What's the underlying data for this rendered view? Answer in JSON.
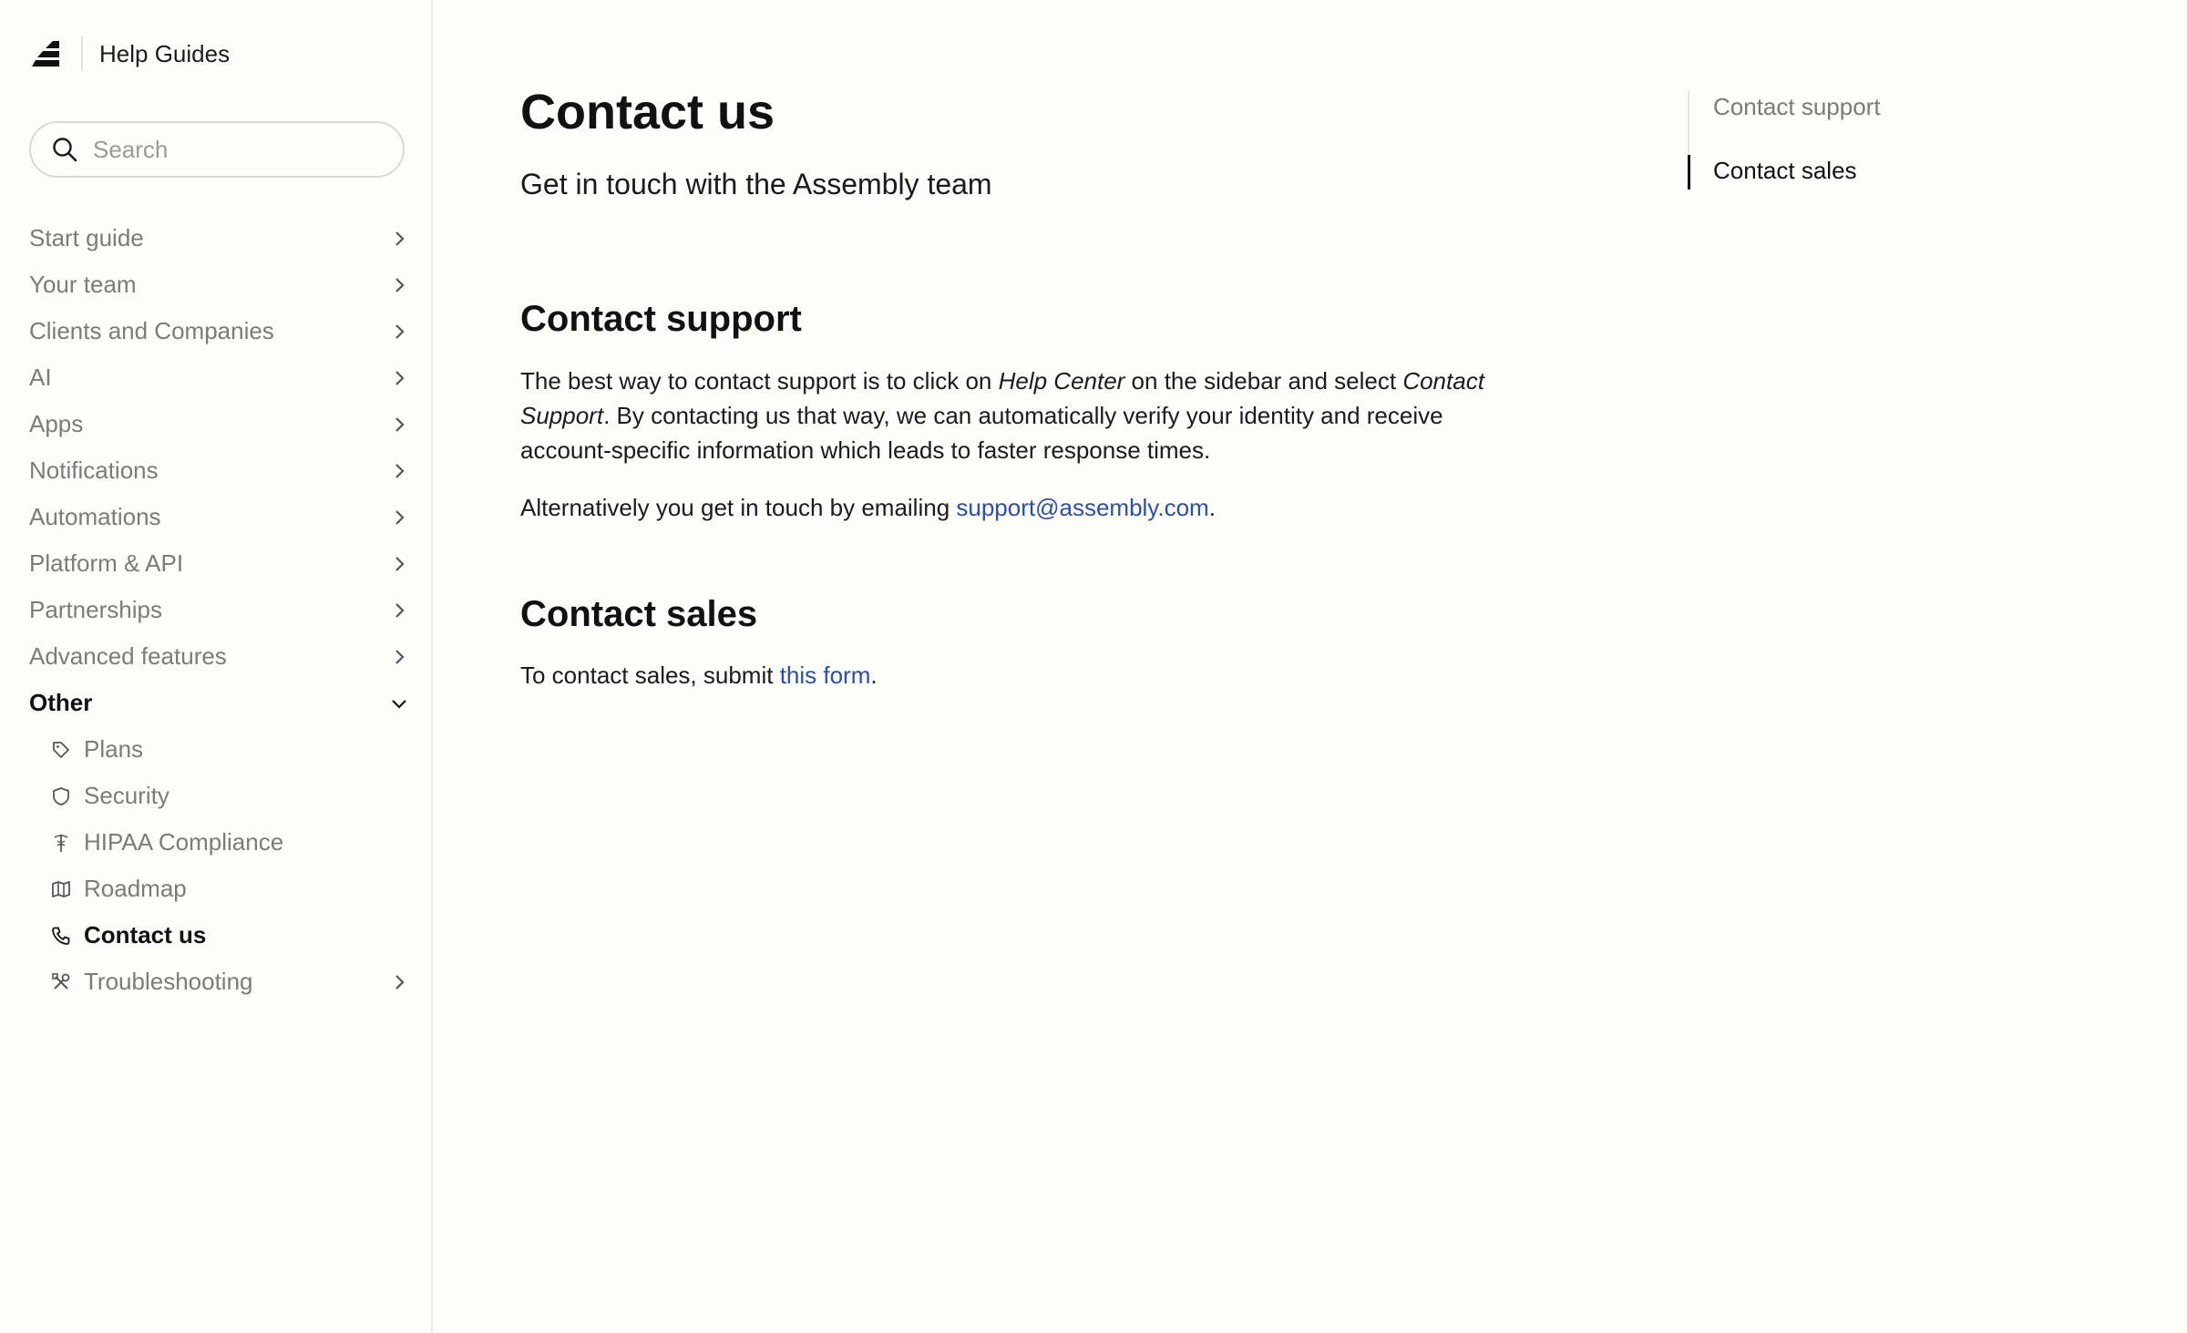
{
  "sidebar": {
    "brand_title": "Help Guides",
    "search_placeholder": "Search",
    "nav": [
      {
        "label": "Start guide"
      },
      {
        "label": "Your team"
      },
      {
        "label": "Clients and Companies"
      },
      {
        "label": "AI"
      },
      {
        "label": "Apps"
      },
      {
        "label": "Notifications"
      },
      {
        "label": "Automations"
      },
      {
        "label": "Platform & API"
      },
      {
        "label": "Partnerships"
      },
      {
        "label": "Advanced features"
      },
      {
        "label": "Other",
        "expanded": true
      }
    ],
    "other_items": [
      {
        "label": "Plans",
        "icon": "tag-icon"
      },
      {
        "label": "Security",
        "icon": "shield-icon"
      },
      {
        "label": "HIPAA Compliance",
        "icon": "caduceus-icon"
      },
      {
        "label": "Roadmap",
        "icon": "map-icon"
      },
      {
        "label": "Contact us",
        "icon": "phone-icon",
        "active": true
      },
      {
        "label": "Troubleshooting",
        "icon": "tools-icon"
      }
    ]
  },
  "main": {
    "title": "Contact us",
    "subtitle": "Get in touch with the Assembly team",
    "support": {
      "heading": "Contact support",
      "p1_a": "The best way to contact support is to click on ",
      "p1_em1": "Help Center",
      "p1_b": " on the sidebar and select ",
      "p1_em2": "Contact Support",
      "p1_c": ". By contacting us that way, we can automatically verify your identity and receive account-specific information which leads to faster response times.",
      "p2_a": "Alternatively you get in touch by emailing ",
      "p2_link": "support@assembly.com",
      "p2_b": "."
    },
    "sales": {
      "heading": "Contact sales",
      "p_a": "To contact sales, submit ",
      "p_link": "this form",
      "p_b": "."
    }
  },
  "toc": {
    "items": [
      {
        "label": "Contact support",
        "active": false
      },
      {
        "label": "Contact sales",
        "active": true
      }
    ]
  },
  "colors": {
    "link": "#2c4fa8",
    "muted": "#7b7b79",
    "text": "#1b1b1b",
    "background": "#fdfdfc"
  }
}
